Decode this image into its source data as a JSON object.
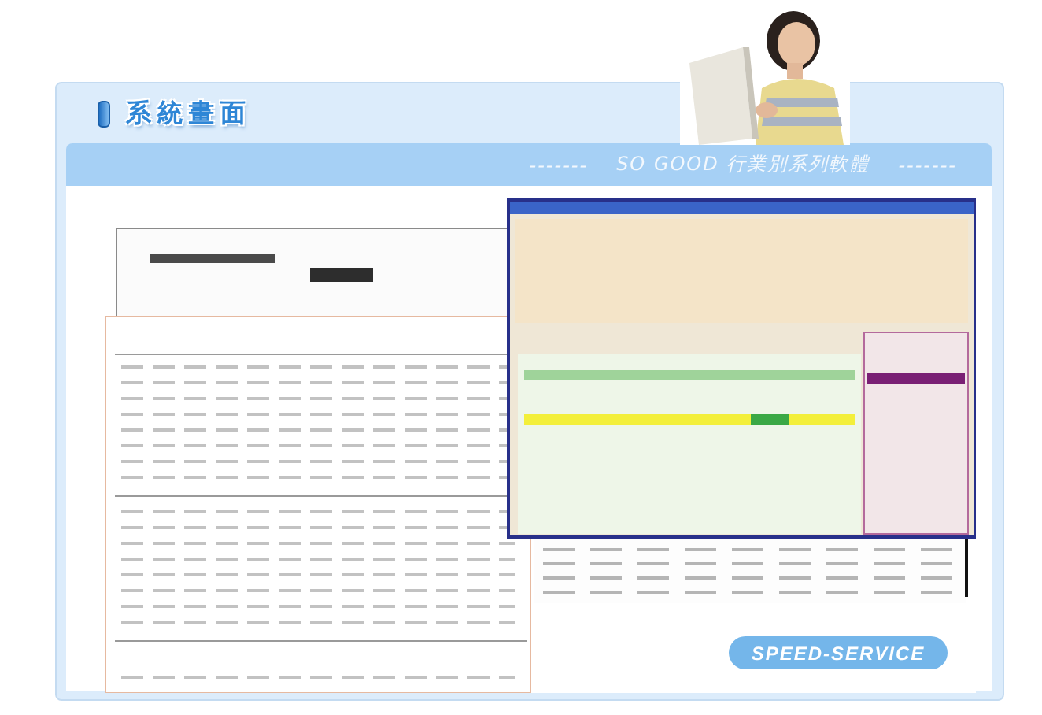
{
  "section_title": "系統畫面",
  "banner": {
    "dashes_left": "-------",
    "text": "SO GOOD 行業別系列軟體",
    "dashes_right": "-------"
  },
  "badge": "SPEED-SERVICE"
}
